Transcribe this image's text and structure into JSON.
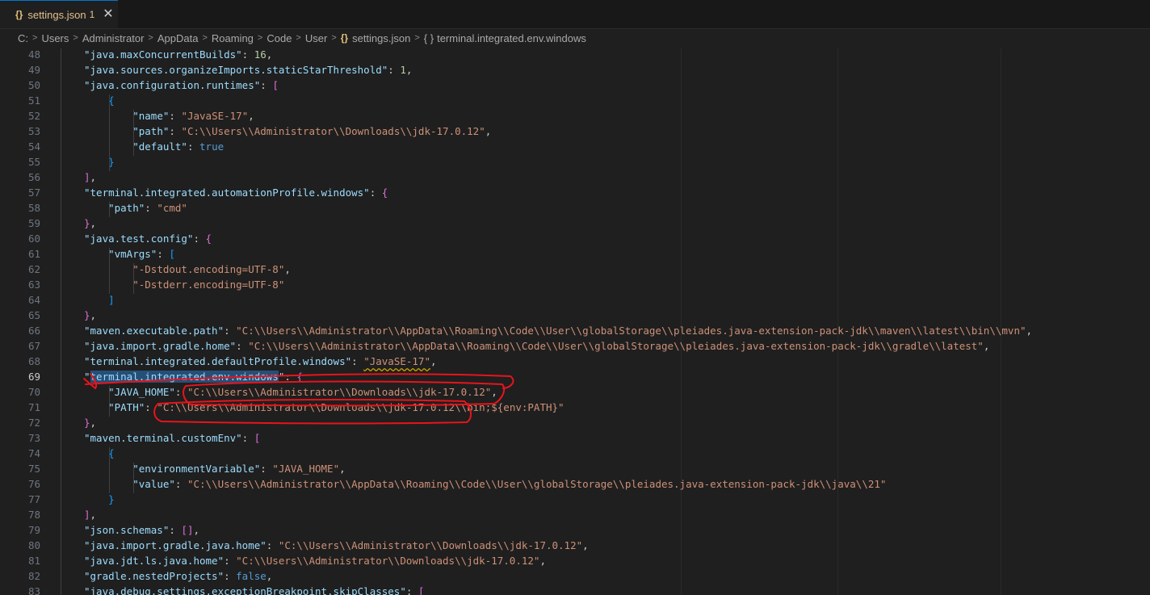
{
  "tab": {
    "icon": "json-braces-icon",
    "filename": "settings.json",
    "problems_count": "1",
    "close_glyph": "✕"
  },
  "breadcrumb": {
    "parts": [
      "C:",
      "Users",
      "Administrator",
      "AppData",
      "Roaming",
      "Code",
      "User"
    ],
    "file": "settings.json",
    "symbol": "terminal.integrated.env.windows"
  },
  "editor": {
    "active_line": 69,
    "lines": [
      {
        "num": "48",
        "tokens": [
          [
            "k",
            "\"java.maxConcurrentBuilds\""
          ],
          [
            "p",
            ": "
          ],
          [
            "n",
            "16"
          ],
          [
            "p",
            ","
          ]
        ]
      },
      {
        "num": "49",
        "tokens": [
          [
            "k",
            "\"java.sources.organizeImports.staticStarThreshold\""
          ],
          [
            "p",
            ": "
          ],
          [
            "n",
            "1"
          ],
          [
            "p",
            ","
          ]
        ]
      },
      {
        "num": "50",
        "tokens": [
          [
            "k",
            "\"java.configuration.runtimes\""
          ],
          [
            "p",
            ": "
          ],
          [
            "br1",
            "["
          ]
        ]
      },
      {
        "num": "51",
        "tokens": [
          [
            "p",
            "    "
          ],
          [
            "br2",
            "{"
          ]
        ]
      },
      {
        "num": "52",
        "tokens": [
          [
            "p",
            "        "
          ],
          [
            "k",
            "\"name\""
          ],
          [
            "p",
            ": "
          ],
          [
            "s",
            "\"JavaSE-17\""
          ],
          [
            "p",
            ","
          ]
        ]
      },
      {
        "num": "53",
        "tokens": [
          [
            "p",
            "        "
          ],
          [
            "k",
            "\"path\""
          ],
          [
            "p",
            ": "
          ],
          [
            "s",
            "\"C:\\\\Users\\\\Administrator\\\\Downloads\\\\jdk-17.0.12\""
          ],
          [
            "p",
            ","
          ]
        ]
      },
      {
        "num": "54",
        "tokens": [
          [
            "p",
            "        "
          ],
          [
            "k",
            "\"default\""
          ],
          [
            "p",
            ": "
          ],
          [
            "b",
            "true"
          ]
        ]
      },
      {
        "num": "55",
        "tokens": [
          [
            "p",
            "    "
          ],
          [
            "br2",
            "}"
          ]
        ]
      },
      {
        "num": "56",
        "tokens": [
          [
            "br1",
            "]"
          ],
          [
            "p",
            ","
          ]
        ]
      },
      {
        "num": "57",
        "tokens": [
          [
            "k",
            "\"terminal.integrated.automationProfile.windows\""
          ],
          [
            "p",
            ": "
          ],
          [
            "br1",
            "{"
          ]
        ]
      },
      {
        "num": "58",
        "tokens": [
          [
            "p",
            "    "
          ],
          [
            "k",
            "\"path\""
          ],
          [
            "p",
            ": "
          ],
          [
            "s",
            "\"cmd\""
          ]
        ]
      },
      {
        "num": "59",
        "tokens": [
          [
            "br1",
            "}"
          ],
          [
            "p",
            ","
          ]
        ]
      },
      {
        "num": "60",
        "tokens": [
          [
            "k",
            "\"java.test.config\""
          ],
          [
            "p",
            ": "
          ],
          [
            "br1",
            "{"
          ]
        ]
      },
      {
        "num": "61",
        "tokens": [
          [
            "p",
            "    "
          ],
          [
            "k",
            "\"vmArgs\""
          ],
          [
            "p",
            ": "
          ],
          [
            "br2",
            "["
          ]
        ]
      },
      {
        "num": "62",
        "tokens": [
          [
            "p",
            "        "
          ],
          [
            "s",
            "\"-Dstdout.encoding=UTF-8\""
          ],
          [
            "p",
            ","
          ]
        ]
      },
      {
        "num": "63",
        "tokens": [
          [
            "p",
            "        "
          ],
          [
            "s",
            "\"-Dstderr.encoding=UTF-8\""
          ]
        ]
      },
      {
        "num": "64",
        "tokens": [
          [
            "p",
            "    "
          ],
          [
            "br2",
            "]"
          ]
        ]
      },
      {
        "num": "65",
        "tokens": [
          [
            "br1",
            "}"
          ],
          [
            "p",
            ","
          ]
        ]
      },
      {
        "num": "66",
        "tokens": [
          [
            "k",
            "\"maven.executable.path\""
          ],
          [
            "p",
            ": "
          ],
          [
            "s",
            "\"C:\\\\Users\\\\Administrator\\\\AppData\\\\Roaming\\\\Code\\\\User\\\\globalStorage\\\\pleiades.java-extension-pack-jdk\\\\maven\\\\latest\\\\bin\\\\mvn\""
          ],
          [
            "p",
            ","
          ]
        ]
      },
      {
        "num": "67",
        "tokens": [
          [
            "k",
            "\"java.import.gradle.home\""
          ],
          [
            "p",
            ": "
          ],
          [
            "s",
            "\"C:\\\\Users\\\\Administrator\\\\AppData\\\\Roaming\\\\Code\\\\User\\\\globalStorage\\\\pleiades.java-extension-pack-jdk\\\\gradle\\\\latest\""
          ],
          [
            "p",
            ","
          ]
        ]
      },
      {
        "num": "68",
        "tokens": [
          [
            "k",
            "\"terminal.integrated.defaultProfile.windows\""
          ],
          [
            "p",
            ": "
          ],
          [
            "sq",
            "\"JavaSE-17\""
          ],
          [
            "p",
            ","
          ]
        ]
      },
      {
        "num": "69",
        "tokens": [
          [
            "k",
            "\""
          ],
          [
            "sel",
            "terminal.integrated.env.windows"
          ],
          [
            "k",
            "\""
          ],
          [
            "p",
            ": "
          ],
          [
            "br1",
            "{"
          ]
        ]
      },
      {
        "num": "70",
        "tokens": [
          [
            "p",
            "    "
          ],
          [
            "k",
            "\"JAVA_HOME\""
          ],
          [
            "p",
            ": "
          ],
          [
            "s",
            "\"C:\\\\Users\\\\Administrator\\\\Downloads\\\\jdk-17.0.12\""
          ],
          [
            "p",
            ","
          ]
        ]
      },
      {
        "num": "71",
        "tokens": [
          [
            "p",
            "    "
          ],
          [
            "k",
            "\"PATH\""
          ],
          [
            "p",
            ": "
          ],
          [
            "s",
            "\"C:\\\\Users\\\\Administrator\\\\Downloads\\\\jdk-17.0.12\\\\bin;${env:PATH}\""
          ]
        ]
      },
      {
        "num": "72",
        "tokens": [
          [
            "br1",
            "}"
          ],
          [
            "p",
            ","
          ]
        ]
      },
      {
        "num": "73",
        "tokens": [
          [
            "k",
            "\"maven.terminal.customEnv\""
          ],
          [
            "p",
            ": "
          ],
          [
            "br1",
            "["
          ]
        ]
      },
      {
        "num": "74",
        "tokens": [
          [
            "p",
            "    "
          ],
          [
            "br2",
            "{"
          ]
        ]
      },
      {
        "num": "75",
        "tokens": [
          [
            "p",
            "        "
          ],
          [
            "k",
            "\"environmentVariable\""
          ],
          [
            "p",
            ": "
          ],
          [
            "s",
            "\"JAVA_HOME\""
          ],
          [
            "p",
            ","
          ]
        ]
      },
      {
        "num": "76",
        "tokens": [
          [
            "p",
            "        "
          ],
          [
            "k",
            "\"value\""
          ],
          [
            "p",
            ": "
          ],
          [
            "s",
            "\"C:\\\\Users\\\\Administrator\\\\AppData\\\\Roaming\\\\Code\\\\User\\\\globalStorage\\\\pleiades.java-extension-pack-jdk\\\\java\\\\21\""
          ]
        ]
      },
      {
        "num": "77",
        "tokens": [
          [
            "p",
            "    "
          ],
          [
            "br2",
            "}"
          ]
        ]
      },
      {
        "num": "78",
        "tokens": [
          [
            "br1",
            "]"
          ],
          [
            "p",
            ","
          ]
        ]
      },
      {
        "num": "79",
        "tokens": [
          [
            "k",
            "\"json.schemas\""
          ],
          [
            "p",
            ": "
          ],
          [
            "br1",
            "[]"
          ],
          [
            "p",
            ","
          ]
        ]
      },
      {
        "num": "80",
        "tokens": [
          [
            "k",
            "\"java.import.gradle.java.home\""
          ],
          [
            "p",
            ": "
          ],
          [
            "s",
            "\"C:\\\\Users\\\\Administrator\\\\Downloads\\\\jdk-17.0.12\""
          ],
          [
            "p",
            ","
          ]
        ]
      },
      {
        "num": "81",
        "tokens": [
          [
            "k",
            "\"java.jdt.ls.java.home\""
          ],
          [
            "p",
            ": "
          ],
          [
            "s",
            "\"C:\\\\Users\\\\Administrator\\\\Downloads\\\\jdk-17.0.12\""
          ],
          [
            "p",
            ","
          ]
        ]
      },
      {
        "num": "82",
        "tokens": [
          [
            "k",
            "\"gradle.nestedProjects\""
          ],
          [
            "p",
            ": "
          ],
          [
            "b",
            "false"
          ],
          [
            "p",
            ","
          ]
        ]
      },
      {
        "num": "83",
        "tokens": [
          [
            "k",
            "\"java.debug.settings.exceptionBreakpoint.skipClasses\""
          ],
          [
            "p",
            ": "
          ],
          [
            "br1",
            "["
          ]
        ]
      }
    ]
  },
  "colors": {
    "background": "#1f1f1f",
    "annotation": "#e8141b",
    "key": "#9cdcfe",
    "string": "#ce9178",
    "number": "#b5cea8",
    "boolean": "#569cd6"
  }
}
